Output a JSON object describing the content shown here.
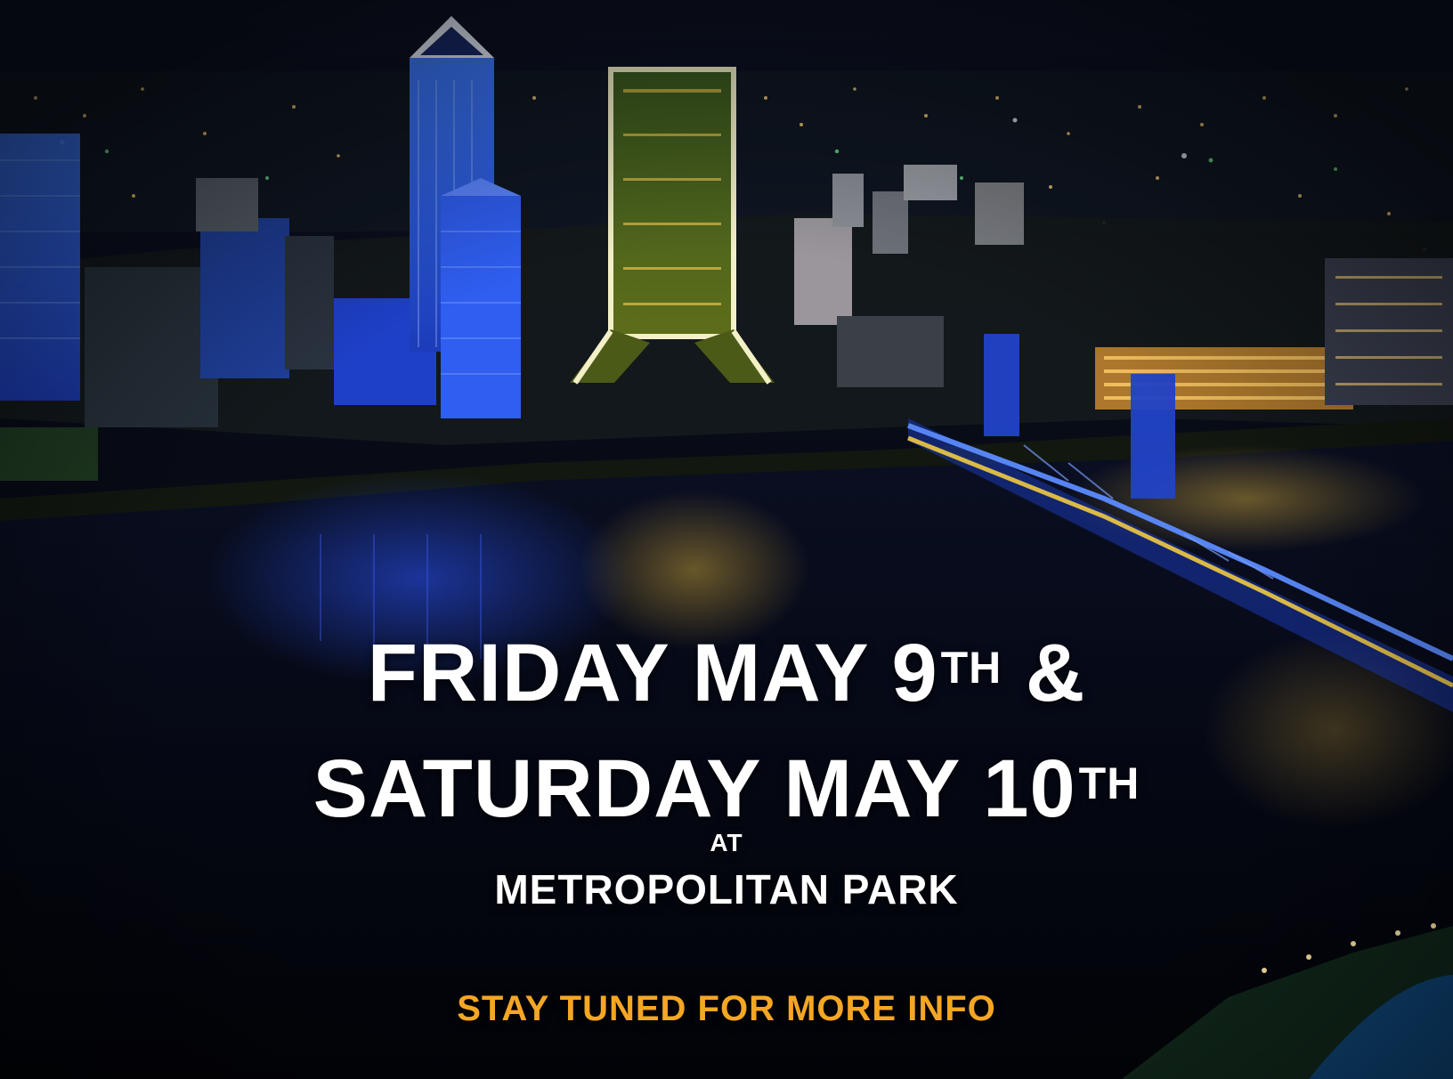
{
  "event": {
    "line1_main": "FRIDAY MAY 9",
    "line1_sup": "TH",
    "line1_tail": " &",
    "line2_main": "SATURDAY MAY 10",
    "line2_sup": "TH",
    "at": "AT",
    "venue": "METROPOLITAN PARK",
    "cta": "STAY TUNED FOR MORE INFO"
  },
  "colors": {
    "headline": "#ffffff",
    "cta": "#f5a623",
    "sky": "#0b1020",
    "water": "#020408"
  }
}
